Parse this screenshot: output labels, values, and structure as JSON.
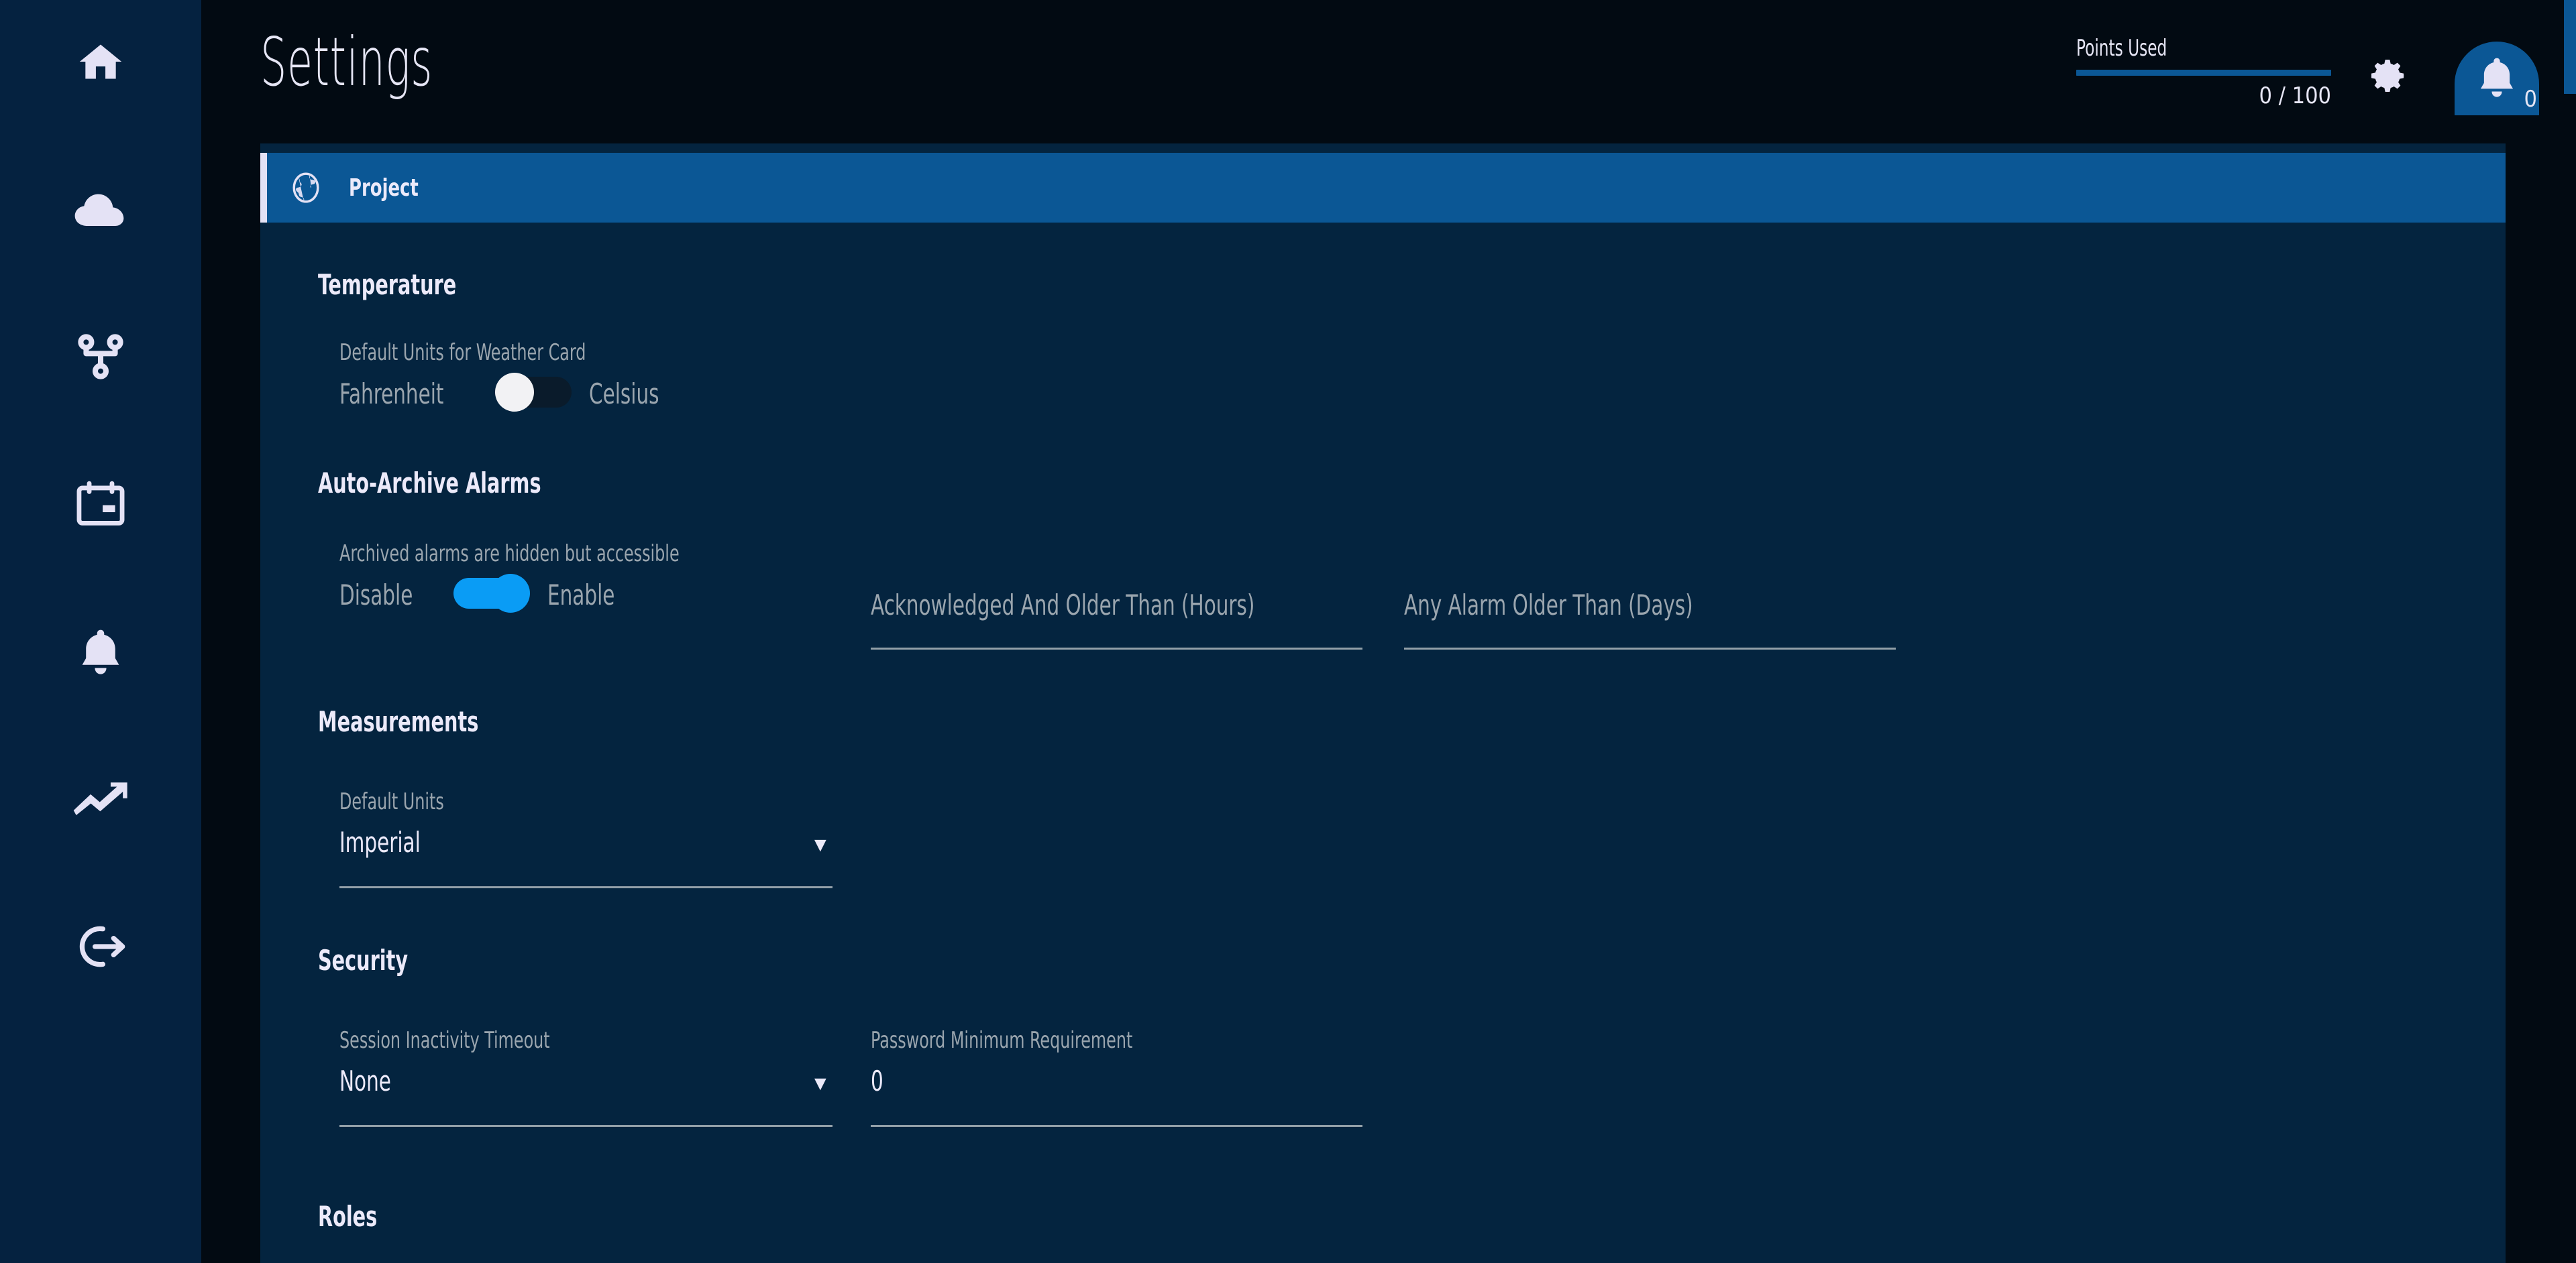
{
  "sidebar": {
    "items": [
      {
        "icon": "home-icon",
        "name": "sidebar-item-home"
      },
      {
        "icon": "cloud-icon",
        "name": "sidebar-item-cloud"
      },
      {
        "icon": "sitemap-icon",
        "name": "sidebar-item-sitemap"
      },
      {
        "icon": "calendar-icon",
        "name": "sidebar-item-calendar"
      },
      {
        "icon": "bell-icon",
        "name": "sidebar-item-alarms"
      },
      {
        "icon": "trend-up-icon",
        "name": "sidebar-item-analytics"
      },
      {
        "icon": "logout-icon",
        "name": "sidebar-item-logout"
      }
    ]
  },
  "header": {
    "title": "Settings",
    "points_label": "Points Used",
    "points_value": "0 / 100",
    "points_used": 0,
    "points_total": 100,
    "gear_icon": "gear-icon",
    "bell_icon": "bell-icon",
    "notification_count": "0"
  },
  "banner": {
    "icon": "globe-icon",
    "label": "Project"
  },
  "sections": {
    "temperature": {
      "title": "Temperature",
      "field_label": "Default Units for Weather Card",
      "option_left": "Fahrenheit",
      "option_right": "Celsius",
      "toggle_state": "off"
    },
    "auto_archive": {
      "title": "Auto-Archive Alarms",
      "field_label": "Archived alarms are hidden but accessible",
      "option_left": "Disable",
      "option_right": "Enable",
      "toggle_state": "on",
      "input_acknowledged_label": "Acknowledged And Older Than (Hours)",
      "input_acknowledged_value": "",
      "input_any_alarm_label": "Any Alarm Older Than (Days)",
      "input_any_alarm_value": ""
    },
    "measurements": {
      "title": "Measurements",
      "field_label": "Default Units",
      "selected_value": "Imperial",
      "arrow_icon": "chevron-down-icon"
    },
    "security": {
      "title": "Security",
      "timeout_label": "Session Inactivity Timeout",
      "timeout_value": "None",
      "timeout_arrow_icon": "chevron-down-icon",
      "password_label": "Password Minimum Requirement",
      "password_value": "0"
    },
    "roles": {
      "title": "Roles"
    }
  },
  "colors": {
    "outer_background": "#020a12",
    "sidebar_background": "#052240",
    "panel_background": "#04243f",
    "accent_blue": "#0b5795",
    "toggle_on": "#0a9cf5",
    "banner_accent": "#e4e2f5",
    "text_primary": "#eceafa",
    "text_muted": "#9aa5ae"
  },
  "scrollbar": {
    "name": "vertical-scrollbar",
    "thumb_position": "top"
  }
}
